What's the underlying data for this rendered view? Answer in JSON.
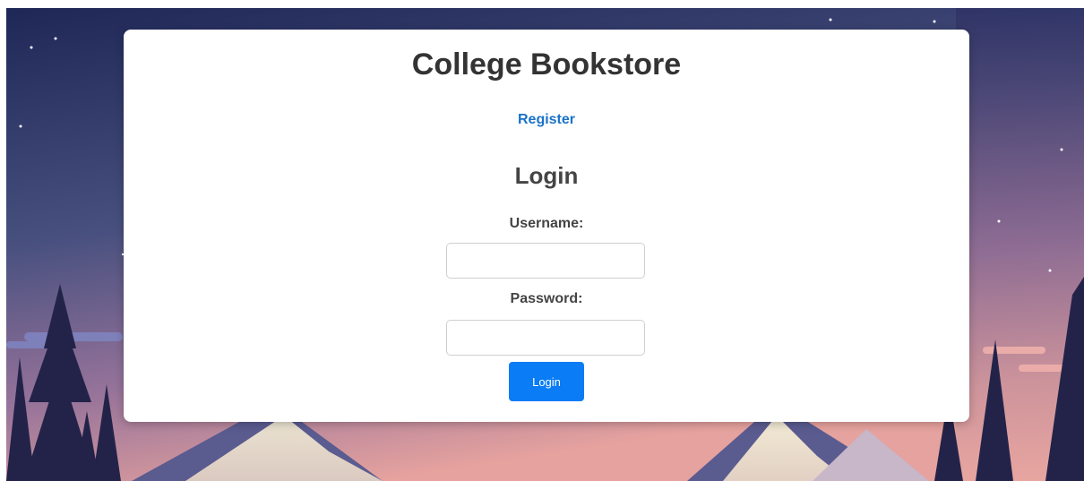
{
  "page": {
    "title": "College Bookstore"
  },
  "nav": {
    "register_label": "Register"
  },
  "login_form": {
    "heading": "Login",
    "username_label": "Username:",
    "username_value": "",
    "password_label": "Password:",
    "password_value": "",
    "submit_label": "Login"
  },
  "colors": {
    "link": "#1a73c8",
    "button": "#0a7cf5",
    "sky_top": "#232c5c",
    "sky_bottom": "#e8a3a0"
  },
  "icons": {
    "background": "mountain-night-landscape"
  }
}
